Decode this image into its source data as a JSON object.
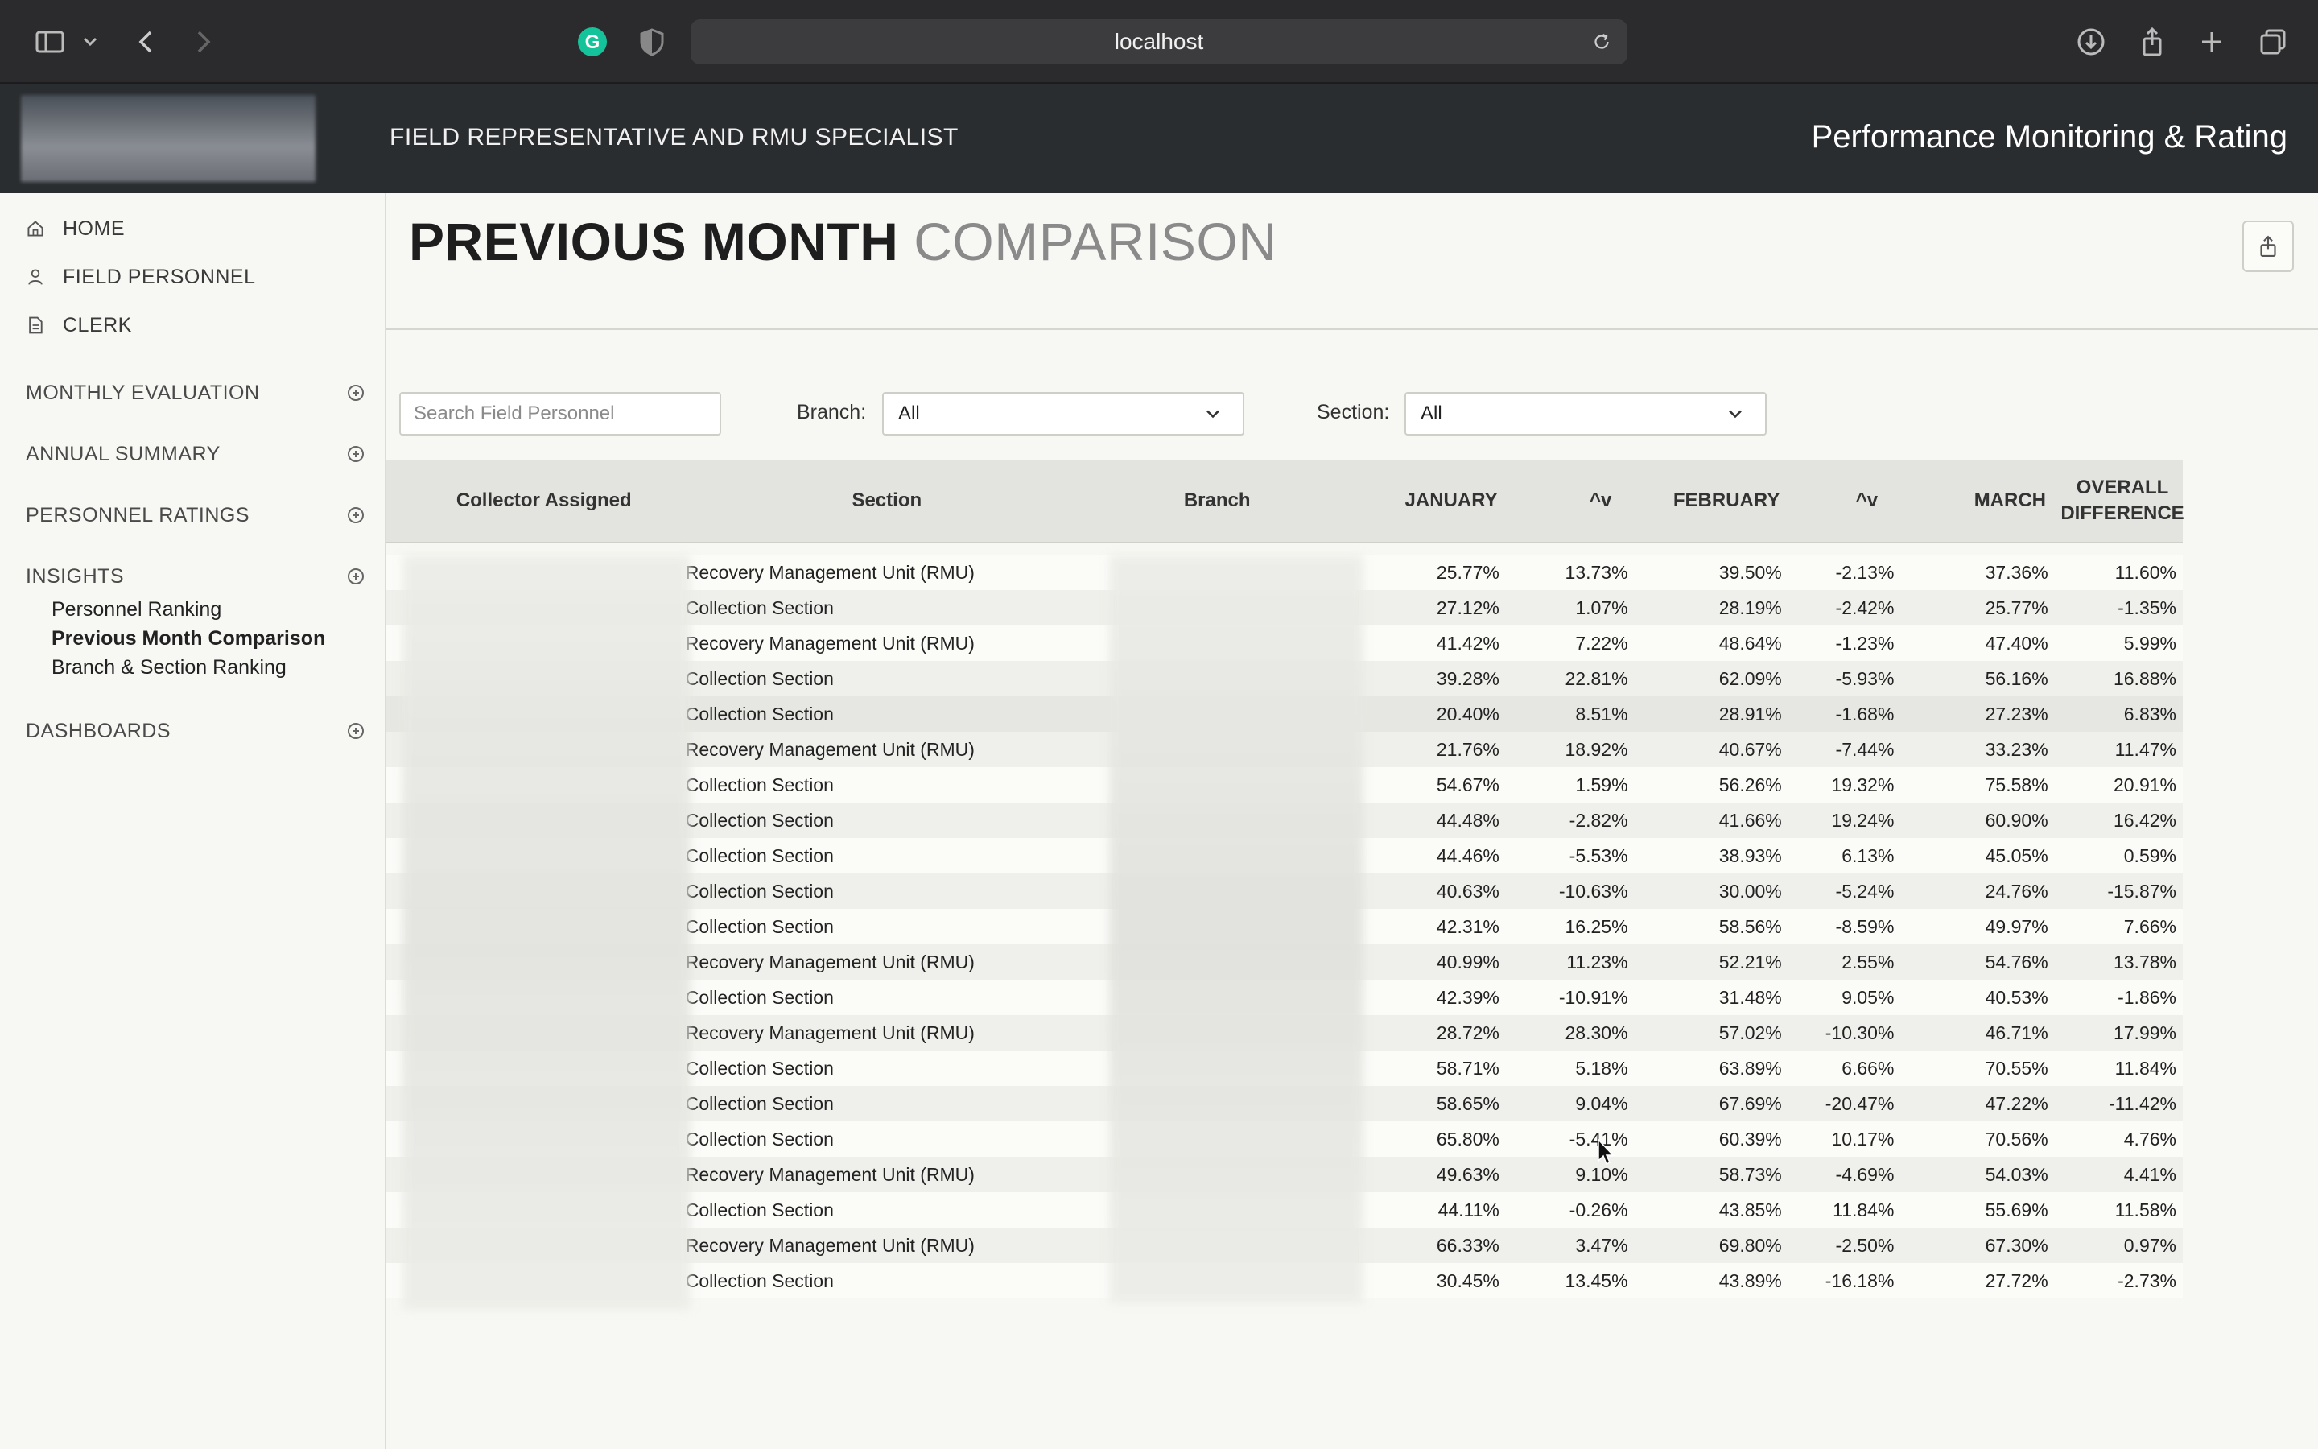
{
  "browser": {
    "url": "localhost"
  },
  "header": {
    "role": "FIELD REPRESENTATIVE AND RMU SPECIALIST",
    "title": "Performance Monitoring & Rating"
  },
  "sidebar": {
    "nav": [
      {
        "label": "HOME",
        "icon": "home-icon"
      },
      {
        "label": "FIELD PERSONNEL",
        "icon": "person-icon"
      },
      {
        "label": "CLERK",
        "icon": "document-icon"
      }
    ],
    "sections": [
      {
        "label": "MONTHLY EVALUATION"
      },
      {
        "label": "ANNUAL SUMMARY"
      },
      {
        "label": "PERSONNEL RATINGS"
      },
      {
        "label": "INSIGHTS"
      },
      {
        "label": "DASHBOARDS"
      }
    ],
    "insights_items": [
      {
        "label": "Personnel Ranking",
        "active": false
      },
      {
        "label": "Previous Month Comparison",
        "active": true
      },
      {
        "label": "Branch & Section Ranking",
        "active": false
      }
    ]
  },
  "page": {
    "title_strong": "PREVIOUS MONTH",
    "title_light": "COMPARISON"
  },
  "filters": {
    "search_placeholder": "Search Field Personnel",
    "branch_label": "Branch:",
    "branch_value": "All",
    "section_label": "Section:",
    "section_value": "All"
  },
  "table": {
    "headers": {
      "collector": "Collector Assigned",
      "section": "Section",
      "branch": "Branch",
      "jan": "JANUARY",
      "d1": "^v",
      "feb": "FEBRUARY",
      "d2": "^v",
      "mar": "MARCH",
      "overall_1": "OVERALL",
      "overall_2": "DIFFERENCE"
    },
    "rows": [
      {
        "section": "Recovery Management Unit (RMU)",
        "jan": "25.77%",
        "d1": "13.73%",
        "feb": "39.50%",
        "d2": "-2.13%",
        "mar": "37.36%",
        "ov": "11.60%"
      },
      {
        "section": "Collection Section",
        "jan": "27.12%",
        "d1": "1.07%",
        "feb": "28.19%",
        "d2": "-2.42%",
        "mar": "25.77%",
        "ov": "-1.35%"
      },
      {
        "section": "Recovery Management Unit (RMU)",
        "jan": "41.42%",
        "d1": "7.22%",
        "feb": "48.64%",
        "d2": "-1.23%",
        "mar": "47.40%",
        "ov": "5.99%"
      },
      {
        "section": "Collection Section",
        "jan": "39.28%",
        "d1": "22.81%",
        "feb": "62.09%",
        "d2": "-5.93%",
        "mar": "56.16%",
        "ov": "16.88%"
      },
      {
        "section": "Collection Section",
        "jan": "20.40%",
        "d1": "8.51%",
        "feb": "28.91%",
        "d2": "-1.68%",
        "mar": "27.23%",
        "ov": "6.83%",
        "hl": true
      },
      {
        "section": "Recovery Management Unit (RMU)",
        "jan": "21.76%",
        "d1": "18.92%",
        "feb": "40.67%",
        "d2": "-7.44%",
        "mar": "33.23%",
        "ov": "11.47%"
      },
      {
        "section": "Collection Section",
        "jan": "54.67%",
        "d1": "1.59%",
        "feb": "56.26%",
        "d2": "19.32%",
        "mar": "75.58%",
        "ov": "20.91%"
      },
      {
        "section": "Collection Section",
        "jan": "44.48%",
        "d1": "-2.82%",
        "feb": "41.66%",
        "d2": "19.24%",
        "mar": "60.90%",
        "ov": "16.42%"
      },
      {
        "section": "Collection Section",
        "jan": "44.46%",
        "d1": "-5.53%",
        "feb": "38.93%",
        "d2": "6.13%",
        "mar": "45.05%",
        "ov": "0.59%"
      },
      {
        "section": "Collection Section",
        "jan": "40.63%",
        "d1": "-10.63%",
        "feb": "30.00%",
        "d2": "-5.24%",
        "mar": "24.76%",
        "ov": "-15.87%"
      },
      {
        "section": "Collection Section",
        "jan": "42.31%",
        "d1": "16.25%",
        "feb": "58.56%",
        "d2": "-8.59%",
        "mar": "49.97%",
        "ov": "7.66%"
      },
      {
        "section": "Recovery Management Unit (RMU)",
        "jan": "40.99%",
        "d1": "11.23%",
        "feb": "52.21%",
        "d2": "2.55%",
        "mar": "54.76%",
        "ov": "13.78%"
      },
      {
        "section": "Collection Section",
        "jan": "42.39%",
        "d1": "-10.91%",
        "feb": "31.48%",
        "d2": "9.05%",
        "mar": "40.53%",
        "ov": "-1.86%"
      },
      {
        "section": "Recovery Management Unit (RMU)",
        "jan": "28.72%",
        "d1": "28.30%",
        "feb": "57.02%",
        "d2": "-10.30%",
        "mar": "46.71%",
        "ov": "17.99%"
      },
      {
        "section": "Collection Section",
        "jan": "58.71%",
        "d1": "5.18%",
        "feb": "63.89%",
        "d2": "6.66%",
        "mar": "70.55%",
        "ov": "11.84%"
      },
      {
        "section": "Collection Section",
        "jan": "58.65%",
        "d1": "9.04%",
        "feb": "67.69%",
        "d2": "-20.47%",
        "mar": "47.22%",
        "ov": "-11.42%"
      },
      {
        "section": "Collection Section",
        "jan": "65.80%",
        "d1": "-5.41%",
        "feb": "60.39%",
        "d2": "10.17%",
        "mar": "70.56%",
        "ov": "4.76%"
      },
      {
        "section": "Recovery Management Unit (RMU)",
        "jan": "49.63%",
        "d1": "9.10%",
        "feb": "58.73%",
        "d2": "-4.69%",
        "mar": "54.03%",
        "ov": "4.41%"
      },
      {
        "section": "Collection Section",
        "jan": "44.11%",
        "d1": "-0.26%",
        "feb": "43.85%",
        "d2": "11.84%",
        "mar": "55.69%",
        "ov": "11.58%"
      },
      {
        "section": "Recovery Management Unit (RMU)",
        "jan": "66.33%",
        "d1": "3.47%",
        "feb": "69.80%",
        "d2": "-2.50%",
        "mar": "67.30%",
        "ov": "0.97%"
      },
      {
        "section": "Collection Section",
        "jan": "30.45%",
        "d1": "13.45%",
        "feb": "43.89%",
        "d2": "-16.18%",
        "mar": "27.72%",
        "ov": "-2.73%"
      }
    ]
  },
  "colors": {
    "positive": "#2a8a2a",
    "negative": "#c0282a",
    "header_bg": "#2a2d30"
  }
}
